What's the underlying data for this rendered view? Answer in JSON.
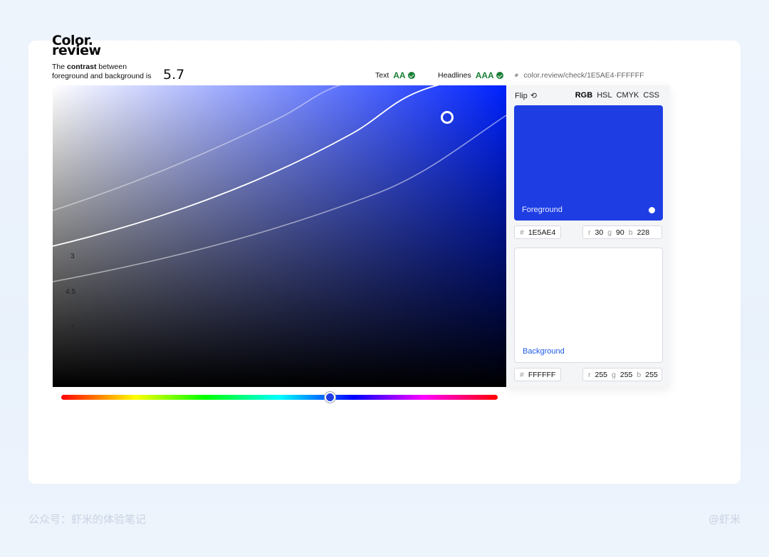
{
  "logo": {
    "line1": "Color.",
    "line2": "review"
  },
  "contrast": {
    "prefix": "The ",
    "bold": "contrast",
    "suffix": " between",
    "line2": "foreground and background is",
    "ratio": "5.7"
  },
  "compliance": {
    "text_label": "Text",
    "text_level": "AA",
    "headlines_label": "Headlines",
    "headlines_level": "AAA",
    "status_color": "#1a7f37"
  },
  "share_url": "color.review/check/1E5AE4-FFFFFF",
  "axis_labels": [
    "3",
    "4.5",
    "7"
  ],
  "panel": {
    "flip_label": "Flip",
    "modes": [
      "RGB",
      "HSL",
      "CMYK",
      "CSS"
    ],
    "active_mode": "RGB",
    "foreground": {
      "label": "Foreground",
      "hex": "1E5AE4",
      "swatch_color": "#1e3ee4",
      "r": "30",
      "g": "90",
      "b": "228"
    },
    "background": {
      "label": "Background",
      "hex": "FFFFFF",
      "swatch_color": "#ffffff",
      "r": "255",
      "g": "255",
      "b": "255"
    },
    "hash": "#",
    "r_label": "r",
    "g_label": "g",
    "b_label": "b"
  },
  "footer": {
    "left": "公众号：虾米的体验笔记",
    "right": "@虾米"
  }
}
